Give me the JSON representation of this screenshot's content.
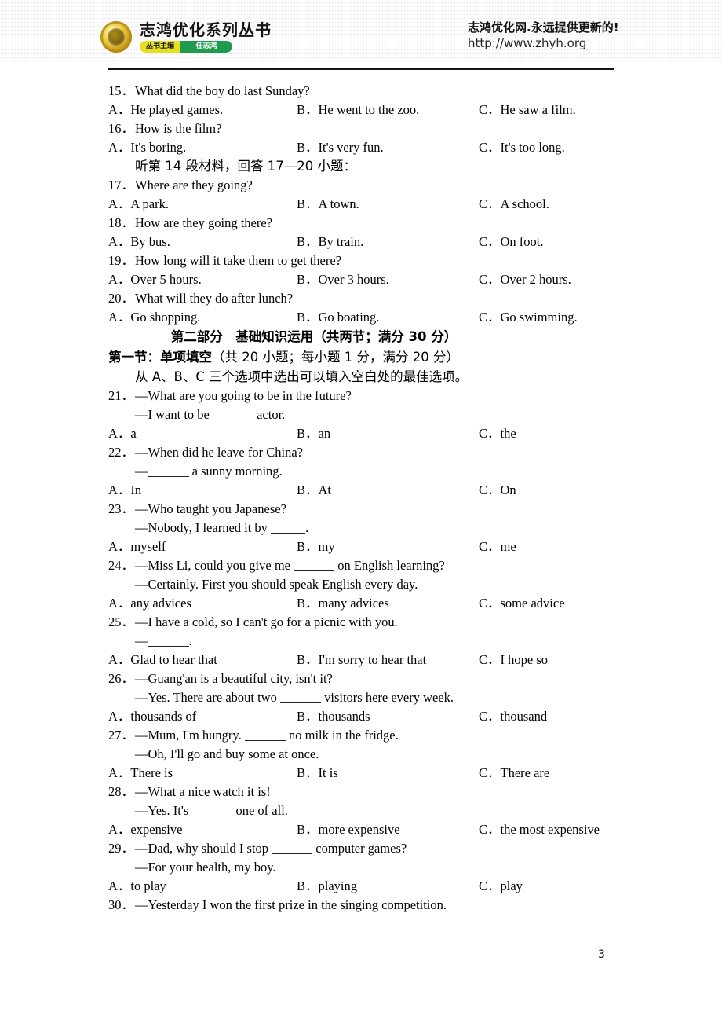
{
  "header": {
    "series_title": "志鸿优化系列丛书",
    "editor_role_label": "丛书主编",
    "editor_name": "任志鸿",
    "promo_cn": "志鸿优化网.永远提供更新的!",
    "promo_url": "http://www.zhyh.org",
    "medallion_icon": "gold-medal-icon",
    "colors": {
      "pill_role_bg": "#e6e020",
      "pill_name_bg": "#1f9b4e",
      "rule": "#151515"
    }
  },
  "listening": {
    "questions": [
      {
        "num": "15．",
        "text": "What did the boy do last Sunday?",
        "options": [
          {
            "letter": "A．",
            "text": "He played games."
          },
          {
            "letter": "B．",
            "text": "He went to the zoo."
          },
          {
            "letter": "C．",
            "text": "He saw a film."
          }
        ]
      },
      {
        "num": "16．",
        "text": "How is the film?",
        "options": [
          {
            "letter": "A．",
            "text": "It's boring."
          },
          {
            "letter": "B．",
            "text": "It's very fun."
          },
          {
            "letter": "C．",
            "text": "It's too long."
          }
        ]
      }
    ],
    "material_note": "听第 14 段材料，回答 17—20 小题：",
    "questions2": [
      {
        "num": "17．",
        "text": "Where are they going?",
        "options": [
          {
            "letter": "A．",
            "text": "A park."
          },
          {
            "letter": "B．",
            "text": "A town."
          },
          {
            "letter": "C．",
            "text": "A school."
          }
        ]
      },
      {
        "num": "18．",
        "text": "How are they going there?",
        "options": [
          {
            "letter": "A．",
            "text": "By bus."
          },
          {
            "letter": "B．",
            "text": "By train."
          },
          {
            "letter": "C．",
            "text": "On foot."
          }
        ]
      },
      {
        "num": "19．",
        "text": "How long will it take them to get there?",
        "options": [
          {
            "letter": "A．",
            "text": "Over 5 hours."
          },
          {
            "letter": "B．",
            "text": "Over 3 hours."
          },
          {
            "letter": "C．",
            "text": "Over 2 hours."
          }
        ]
      },
      {
        "num": "20．",
        "text": "What will they do after lunch?",
        "options": [
          {
            "letter": "A．",
            "text": "Go shopping."
          },
          {
            "letter": "B．",
            "text": "Go boating."
          },
          {
            "letter": "C．",
            "text": "Go swimming."
          }
        ]
      }
    ]
  },
  "part2": {
    "heading": "第二部分　基础知识运用（共两节；满分 30 分）",
    "section1_bold": "第一节：单项填空",
    "section1_normal": "（共 20 小题；每小题 1 分，满分 20 分）",
    "instruction": "从 A、B、C 三个选项中选出可以填入空白处的最佳选项。",
    "questions": [
      {
        "num": "21．",
        "line1": "—What are you going to be in the future?",
        "line2_pre": "—I want to be ",
        "line2_post": " actor.",
        "options": [
          {
            "letter": "A．",
            "text": "a"
          },
          {
            "letter": "B．",
            "text": "an"
          },
          {
            "letter": "C．",
            "text": "the"
          }
        ]
      },
      {
        "num": "22．",
        "line1": "—When did he leave for China?",
        "line2_pre": "—",
        "line2_post": " a sunny morning.",
        "options": [
          {
            "letter": "A．",
            "text": "In"
          },
          {
            "letter": "B．",
            "text": "At"
          },
          {
            "letter": "C．",
            "text": "On"
          }
        ]
      },
      {
        "num": "23．",
        "line1": "—Who taught you Japanese?",
        "line2_pre": "—Nobody, I learned it by ",
        "line2_post": ".",
        "options": [
          {
            "letter": "A．",
            "text": "myself"
          },
          {
            "letter": "B．",
            "text": "my"
          },
          {
            "letter": "C．",
            "text": "me"
          }
        ]
      },
      {
        "num": "24．",
        "line1_pre": "—Miss Li, could you give me ",
        "line1_post": " on English learning?",
        "line2": "—Certainly. First you should speak English every day.",
        "options": [
          {
            "letter": "A．",
            "text": "any advices"
          },
          {
            "letter": "B．",
            "text": "many advices"
          },
          {
            "letter": "C．",
            "text": "some advice"
          }
        ]
      },
      {
        "num": "25．",
        "line1": "—I have a cold, so I can't go for a picnic with you.",
        "line2_pre": "—",
        "line2_post": ".",
        "options": [
          {
            "letter": "A．",
            "text": "Glad to hear that"
          },
          {
            "letter": "B．",
            "text": "I'm sorry to hear that"
          },
          {
            "letter": "C．",
            "text": "I hope so"
          }
        ]
      },
      {
        "num": "26．",
        "line1": "—Guang'an is a beautiful city, isn't it?",
        "line2_pre": "—Yes. There are about two ",
        "line2_post": " visitors here every week.",
        "options": [
          {
            "letter": "A．",
            "text": "thousands of"
          },
          {
            "letter": "B．",
            "text": "thousands"
          },
          {
            "letter": "C．",
            "text": "thousand"
          }
        ]
      },
      {
        "num": "27．",
        "line1_pre": "—Mum, I'm hungry. ",
        "line1_post": " no milk in the fridge.",
        "line2": "—Oh, I'll go and buy some at once.",
        "options": [
          {
            "letter": "A．",
            "text": "There is"
          },
          {
            "letter": "B．",
            "text": "It is"
          },
          {
            "letter": "C．",
            "text": "There are"
          }
        ]
      },
      {
        "num": "28．",
        "line1": "—What a nice watch it is!",
        "line2_pre": "—Yes. It's ",
        "line2_post": " one of all.",
        "options": [
          {
            "letter": "A．",
            "text": "expensive"
          },
          {
            "letter": "B．",
            "text": "more expensive"
          },
          {
            "letter": "C．",
            "text": "the most expensive"
          }
        ]
      },
      {
        "num": "29．",
        "line1_pre": "—Dad, why should I stop ",
        "line1_post": " computer games?",
        "line2": "—For your health, my boy.",
        "options": [
          {
            "letter": "A．",
            "text": "to play"
          },
          {
            "letter": "B．",
            "text": "playing"
          },
          {
            "letter": "C．",
            "text": "play"
          }
        ]
      },
      {
        "num": "30．",
        "line1": "—Yesterday I won the first prize in the singing competition.",
        "options": []
      }
    ]
  },
  "footer": {
    "page_number": "3"
  }
}
